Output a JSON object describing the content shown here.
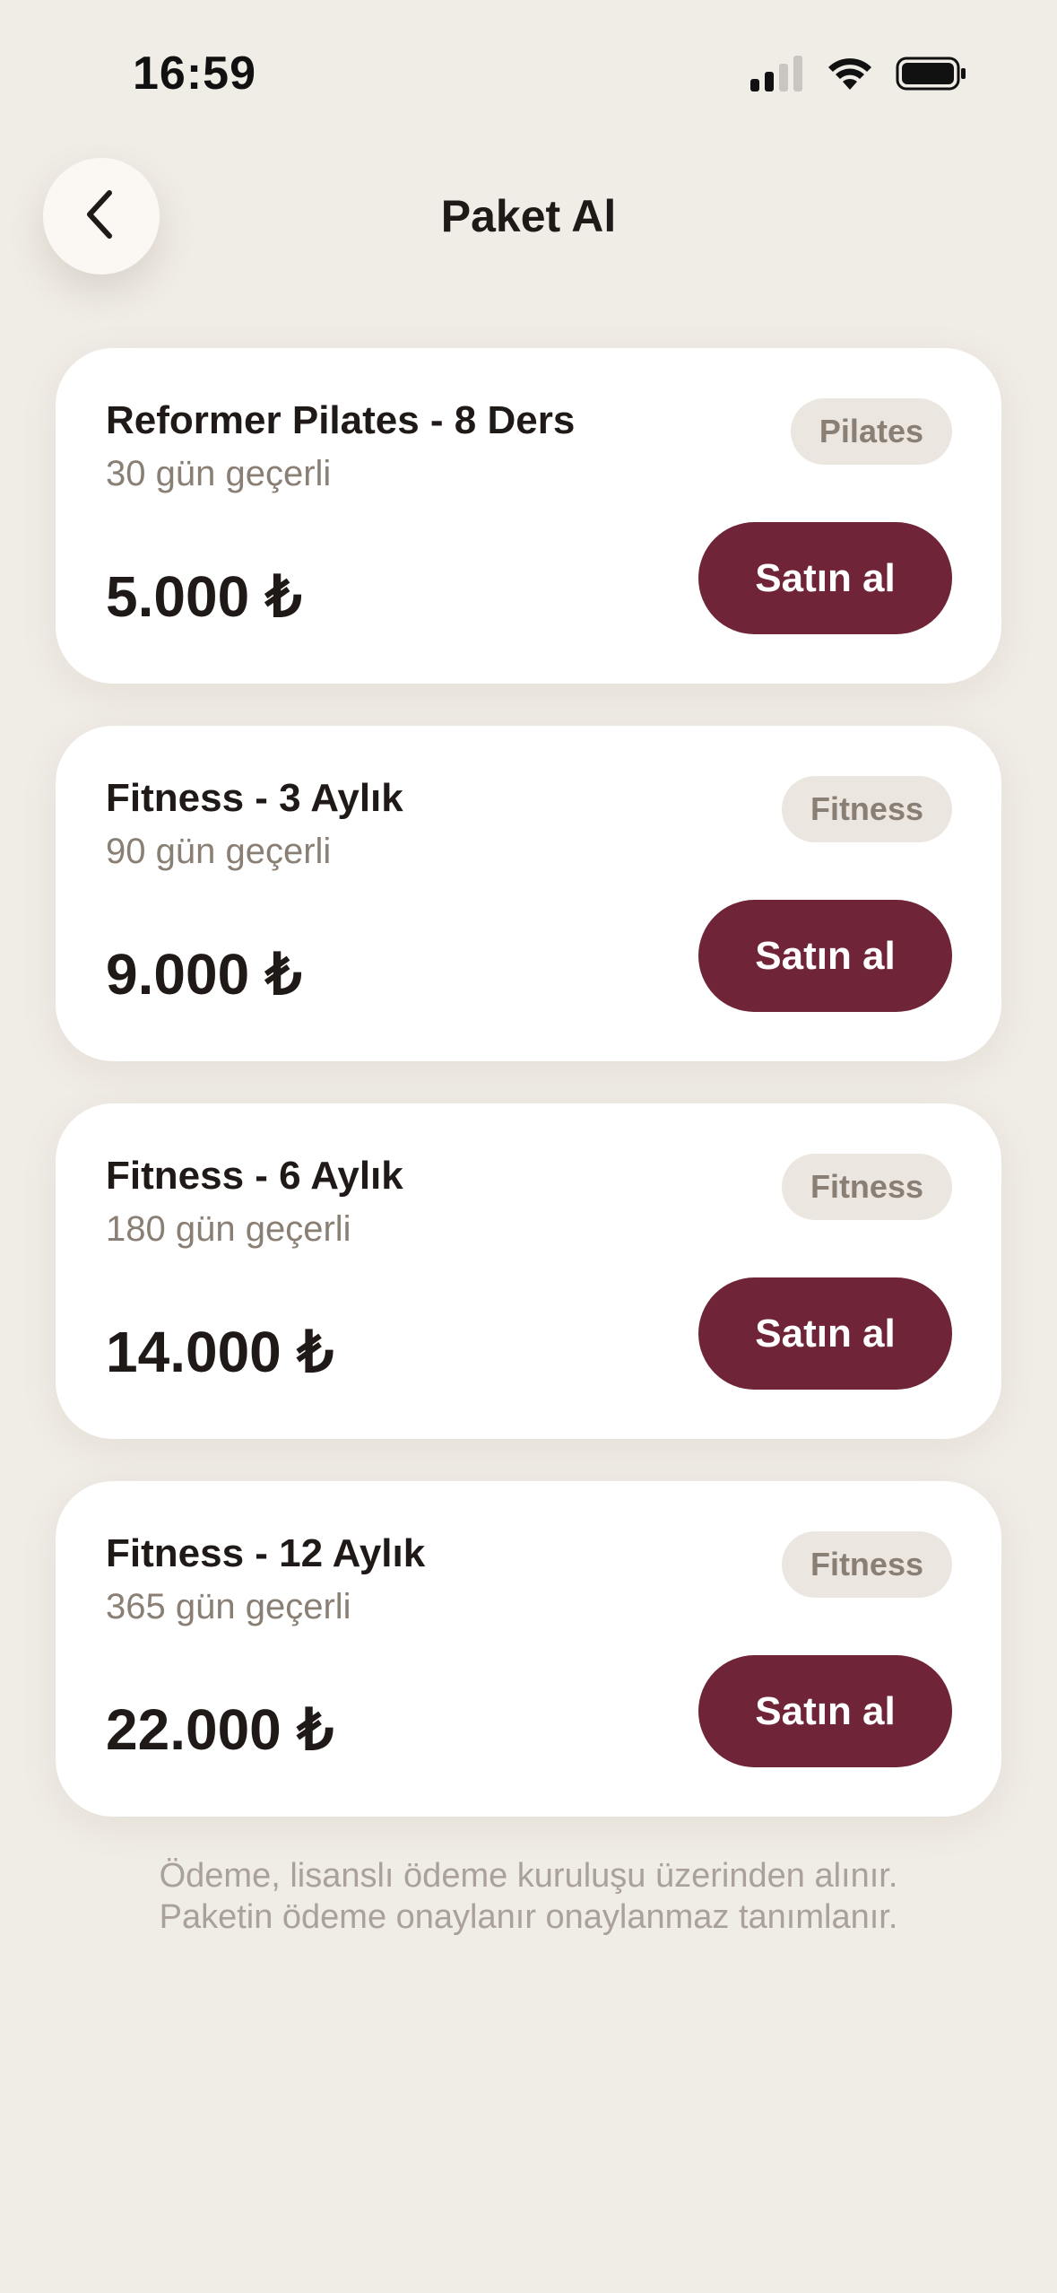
{
  "status_bar": {
    "time": "16:59"
  },
  "header": {
    "title": "Paket Al",
    "back_icon": "chevron-left-icon"
  },
  "packages": [
    {
      "name": "Reformer Pilates - 8 Ders",
      "validity": "30 gün geçerli",
      "price": "5.000 ₺",
      "category": "Pilates",
      "button_label": "Satın al"
    },
    {
      "name": "Fitness - 3 Aylık",
      "validity": "90 gün geçerli",
      "price": "9.000 ₺",
      "category": "Fitness",
      "button_label": "Satın al"
    },
    {
      "name": "Fitness - 6 Aylık",
      "validity": "180 gün geçerli",
      "price": "14.000 ₺",
      "category": "Fitness",
      "button_label": "Satın al"
    },
    {
      "name": "Fitness - 12 Aylık",
      "validity": "365 gün geçerli",
      "price": "22.000 ₺",
      "category": "Fitness",
      "button_label": "Satın al"
    }
  ],
  "footnote": {
    "line1": "Ödeme, lisanslı ödeme kuruluşu üzerinden alınır.",
    "line2": "Paketin ödeme onaylanır onaylanmaz tanımlanır."
  },
  "colors": {
    "background": "#f0ece6",
    "accent": "#6f2438",
    "badge_bg": "#ebe6df"
  }
}
